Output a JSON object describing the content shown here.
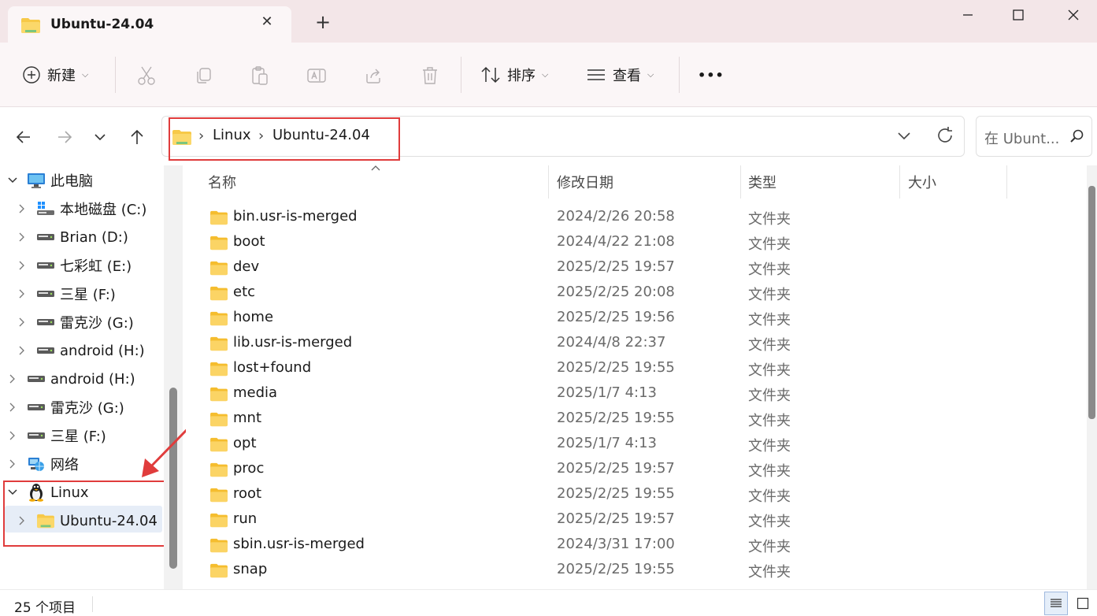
{
  "window": {
    "tab_title": "Ubuntu-24.04",
    "new_tab_symbol": "+",
    "close_tab_symbol": "✕"
  },
  "toolbar": {
    "new_label": "新建",
    "sort_label": "排序",
    "view_label": "查看",
    "more_symbol": "•••",
    "icons": [
      "cut-icon",
      "copy-icon",
      "paste-icon",
      "rename-icon",
      "share-icon",
      "delete-icon"
    ]
  },
  "address": {
    "crumbs": [
      "Linux",
      "Ubuntu-24.04"
    ],
    "search_placeholder": "在 Ubunt..."
  },
  "sidebar": {
    "items": [
      {
        "label": "此电脑",
        "icon": "computer-icon",
        "level": 0,
        "expanded": true
      },
      {
        "label": "本地磁盘 (C:)",
        "icon": "windows-drive-icon",
        "level": 1,
        "expanded": false
      },
      {
        "label": "Brian (D:)",
        "icon": "drive-icon",
        "level": 1,
        "expanded": false
      },
      {
        "label": "七彩虹 (E:)",
        "icon": "drive-icon",
        "level": 1,
        "expanded": false
      },
      {
        "label": "三星 (F:)",
        "icon": "drive-icon",
        "level": 1,
        "expanded": false
      },
      {
        "label": "雷克沙 (G:)",
        "icon": "drive-icon",
        "level": 1,
        "expanded": false
      },
      {
        "label": "android (H:)",
        "icon": "drive-icon",
        "level": 1,
        "expanded": false
      },
      {
        "label": "android (H:)",
        "icon": "drive-icon",
        "level": 0,
        "expanded": false
      },
      {
        "label": "雷克沙 (G:)",
        "icon": "drive-icon",
        "level": 0,
        "expanded": false
      },
      {
        "label": "三星 (F:)",
        "icon": "drive-icon",
        "level": 0,
        "expanded": false
      },
      {
        "label": "网络",
        "icon": "network-icon",
        "level": 0,
        "expanded": false
      },
      {
        "label": "Linux",
        "icon": "linux-penguin-icon",
        "level": 0,
        "expanded": true
      },
      {
        "label": "Ubuntu-24.04",
        "icon": "folder-icon",
        "level": 1,
        "expanded": false,
        "selected": true
      }
    ]
  },
  "columns": {
    "name": "名称",
    "modified": "修改日期",
    "type": "类型",
    "size": "大小"
  },
  "files": [
    {
      "name": "bin.usr-is-merged",
      "modified": "2024/2/26 20:58",
      "type": "文件夹"
    },
    {
      "name": "boot",
      "modified": "2024/4/22 21:08",
      "type": "文件夹"
    },
    {
      "name": "dev",
      "modified": "2025/2/25 19:57",
      "type": "文件夹"
    },
    {
      "name": "etc",
      "modified": "2025/2/25 20:08",
      "type": "文件夹"
    },
    {
      "name": "home",
      "modified": "2025/2/25 19:56",
      "type": "文件夹"
    },
    {
      "name": "lib.usr-is-merged",
      "modified": "2024/4/8 22:37",
      "type": "文件夹"
    },
    {
      "name": "lost+found",
      "modified": "2025/2/25 19:55",
      "type": "文件夹"
    },
    {
      "name": "media",
      "modified": "2025/1/7 4:13",
      "type": "文件夹"
    },
    {
      "name": "mnt",
      "modified": "2025/2/25 19:55",
      "type": "文件夹"
    },
    {
      "name": "opt",
      "modified": "2025/1/7 4:13",
      "type": "文件夹"
    },
    {
      "name": "proc",
      "modified": "2025/2/25 19:57",
      "type": "文件夹"
    },
    {
      "name": "root",
      "modified": "2025/2/25 19:55",
      "type": "文件夹"
    },
    {
      "name": "run",
      "modified": "2025/2/25 19:57",
      "type": "文件夹"
    },
    {
      "name": "sbin.usr-is-merged",
      "modified": "2024/3/31 17:00",
      "type": "文件夹"
    },
    {
      "name": "snap",
      "modified": "2025/2/25 19:55",
      "type": "文件夹"
    }
  ],
  "status": {
    "item_count": "25 个项目"
  },
  "colors": {
    "titlebar_bg": "#f3e6e8",
    "toolbar_bg": "#fbf6f7",
    "highlight_red": "#e03c3c",
    "selection_bg": "#e6edf7",
    "folder_yellow": "#f7c948"
  }
}
